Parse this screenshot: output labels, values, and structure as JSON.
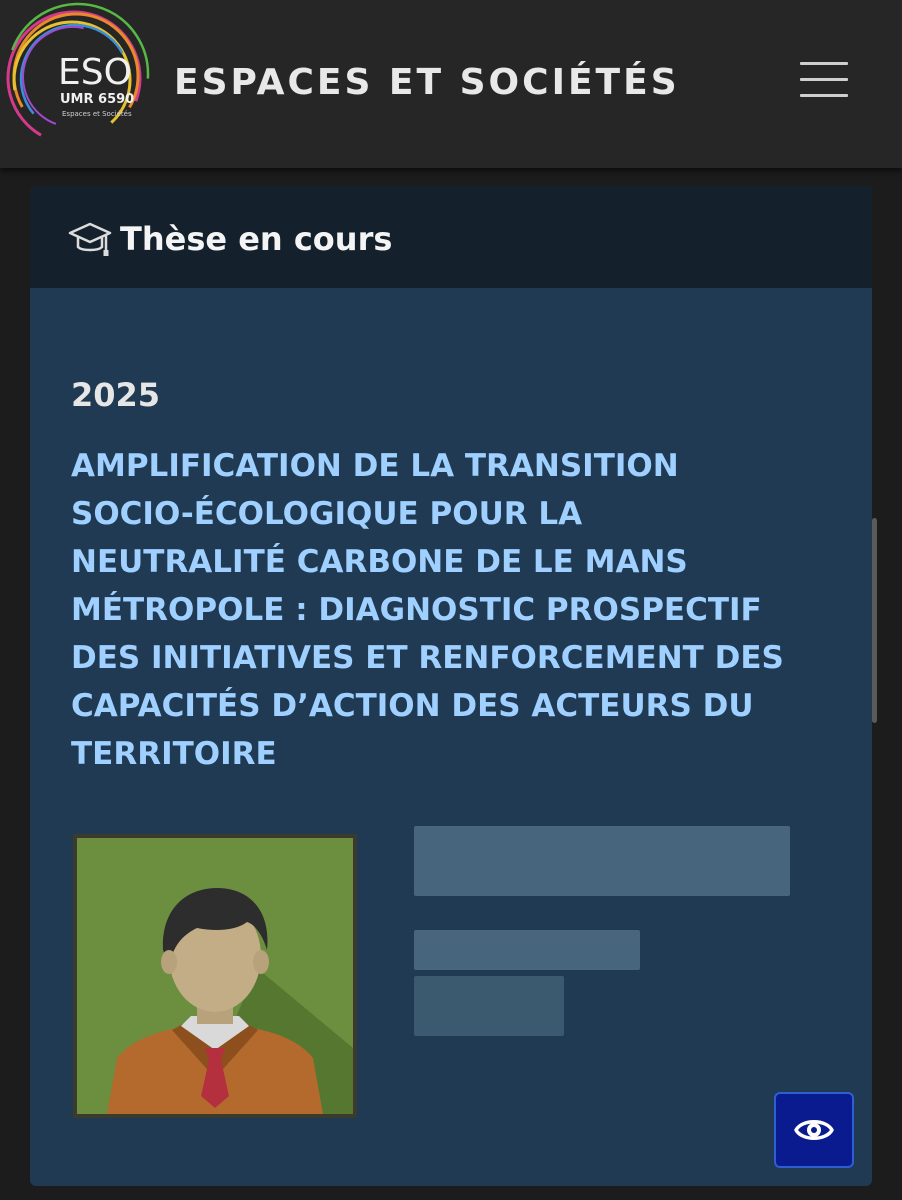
{
  "header": {
    "logo": {
      "acronym": "ESO",
      "unit": "UMR 6590",
      "subtitle": "Espaces et Sociétés"
    },
    "site_title": "ESPACES ET SOCIÉTÉS",
    "menu_icon": "hamburger-menu-icon"
  },
  "card": {
    "section_icon": "graduation-cap-icon",
    "section_title": "Thèse en cours",
    "year": "2025",
    "thesis_title_lines": [
      "AMPLIFICATION DE LA TRANSITION",
      "SOCIO-ÉCOLOGIQUE POUR LA",
      "NEUTRALITÉ CARBONE DE LE MANS",
      "MÉTROPOLE : DIAGNOSTIC PROSPECTIF",
      "DES INITIATIVES ET RENFORCEMENT DES",
      "CAPACITÉS D’ACTION DES ACTEURS DU",
      "TERRITOIRE"
    ],
    "avatar_icon": "person-avatar-icon"
  },
  "accessibility_button": {
    "icon": "eye-icon"
  },
  "colors": {
    "header_bg": "#262626",
    "card_bg": "#1f3a52",
    "card_header_bg": "#14202b",
    "title_color": "#9fd0ff",
    "button_bg": "#0a1a8f"
  }
}
